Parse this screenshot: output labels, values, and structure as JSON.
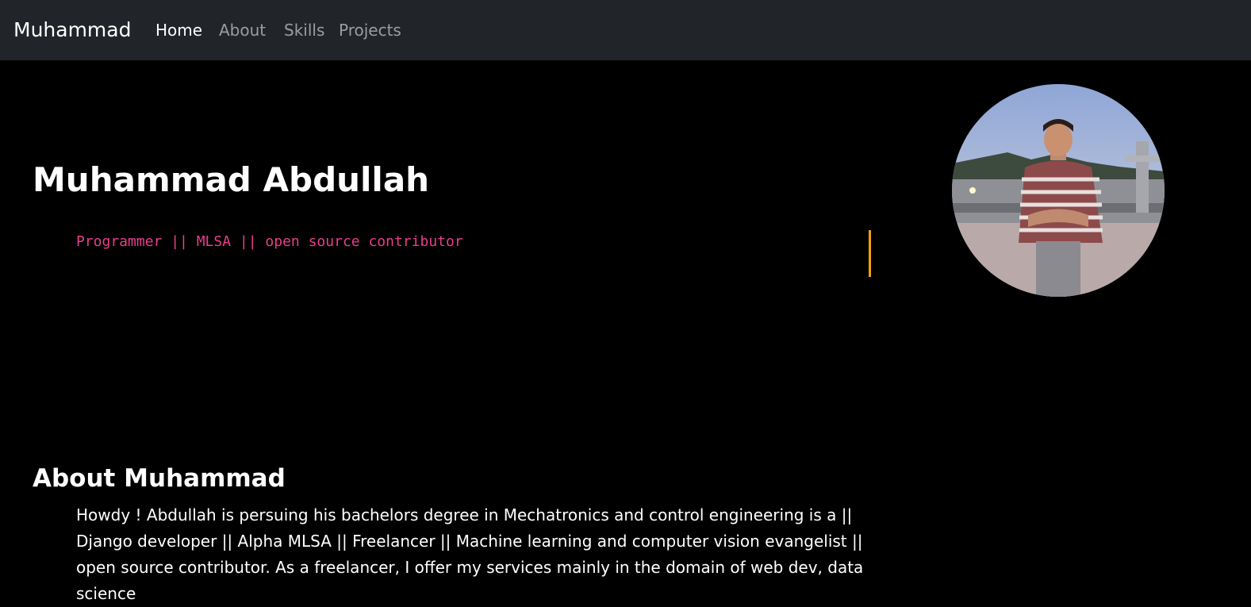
{
  "navbar": {
    "brand": "Muhammad",
    "links": [
      {
        "label": "Home",
        "active": true
      },
      {
        "label": "About",
        "active": false
      },
      {
        "label": "Skills",
        "active": false
      },
      {
        "label": "Projects",
        "active": false
      }
    ]
  },
  "hero": {
    "name": "Muhammad Abdullah",
    "tagline": "Programmer || MLSA || open source contributor",
    "avatar_icon": "profile-photo"
  },
  "about": {
    "title": "About Muhammad",
    "text": "Howdy ! Abdullah is persuing his bachelors degree in Mechatronics and control engineering is a || Django developer || Alpha MLSA || Freelancer || Machine learning and computer vision evangelist || open source contributor. As a freelancer, I offer my services mainly in the domain of web dev, data science"
  },
  "colors": {
    "navbar_bg": "#212529",
    "page_bg": "#000000",
    "tagline": "#e83e8c",
    "cursor": "#f0a30a"
  }
}
